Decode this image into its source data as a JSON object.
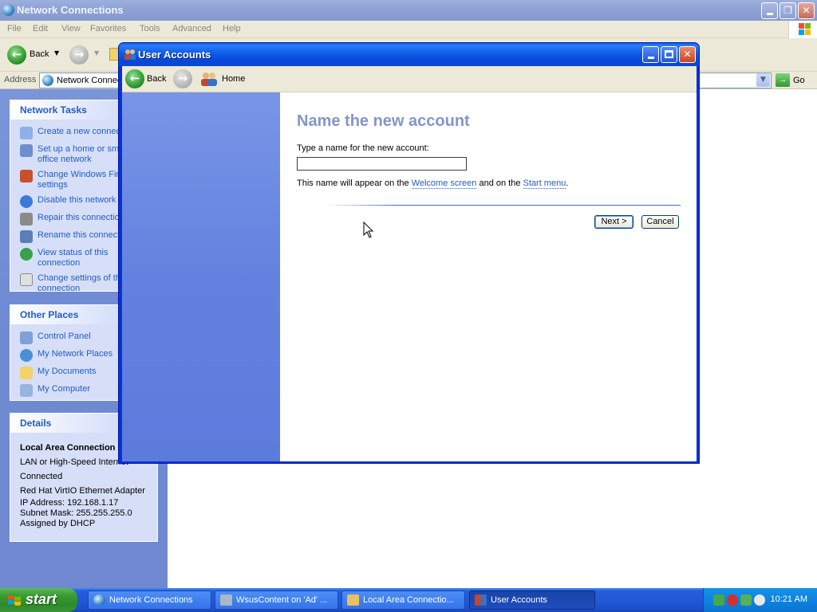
{
  "explorer": {
    "title": "Network Connections",
    "menu": [
      "File",
      "Edit",
      "View",
      "Favorites",
      "Tools",
      "Advanced",
      "Help"
    ],
    "toolbar": {
      "back_label": "Back"
    },
    "address": {
      "label": "Address",
      "value": "Network Connections",
      "go_label": "Go"
    },
    "network_tasks": {
      "title": "Network Tasks",
      "items": [
        {
          "label": "Create a new connection",
          "icon": "new-connection-icon"
        },
        {
          "label": "Set up a home or small office network",
          "icon": "home-network-icon"
        },
        {
          "label": "Change Windows Firewall settings",
          "icon": "firewall-icon"
        },
        {
          "label": "Disable this network device",
          "icon": "disable-network-icon"
        },
        {
          "label": "Repair this connection",
          "icon": "repair-icon"
        },
        {
          "label": "Rename this connection",
          "icon": "rename-icon"
        },
        {
          "label": "View status of this connection",
          "icon": "status-icon"
        },
        {
          "label": "Change settings of this connection",
          "icon": "settings-icon"
        }
      ]
    },
    "other_places": {
      "title": "Other Places",
      "items": [
        {
          "label": "Control Panel",
          "icon": "control-panel-icon"
        },
        {
          "label": "My Network Places",
          "icon": "network-places-icon"
        },
        {
          "label": "My Documents",
          "icon": "documents-icon"
        },
        {
          "label": "My Computer",
          "icon": "computer-icon"
        }
      ]
    },
    "details": {
      "title": "Details",
      "name": "Local Area Connection",
      "type": "LAN or High-Speed Internet",
      "status": "Connected",
      "adapter": "Red Hat VirtIO Ethernet Adapter",
      "ip": "IP Address: 192.168.1.17",
      "mask": "Subnet Mask: 255.255.255.0",
      "assigned": "Assigned by DHCP"
    }
  },
  "dialog": {
    "title": "User Accounts",
    "nav": {
      "back_label": "Back",
      "home_label": "Home"
    },
    "heading": "Name the new account",
    "prompt": "Type a name for the new account:",
    "input_value": "",
    "note_before": "This name will appear on the ",
    "note_link1": "Welcome screen",
    "note_middle": " and on the ",
    "note_link2": "Start menu",
    "note_after": ".",
    "next_label": "Next >",
    "cancel_label": "Cancel"
  },
  "taskbar": {
    "start_label": "start",
    "tasks": [
      {
        "label": "Network Connections",
        "icon": "network-connections-icon"
      },
      {
        "label": "WsusContent on 'Ad' ...",
        "icon": "network-drive-icon"
      },
      {
        "label": "Local Area Connectio...",
        "icon": "lan-icon"
      },
      {
        "label": "User Accounts",
        "icon": "user-accounts-icon",
        "active": true
      }
    ],
    "clock": "10:21 AM"
  }
}
